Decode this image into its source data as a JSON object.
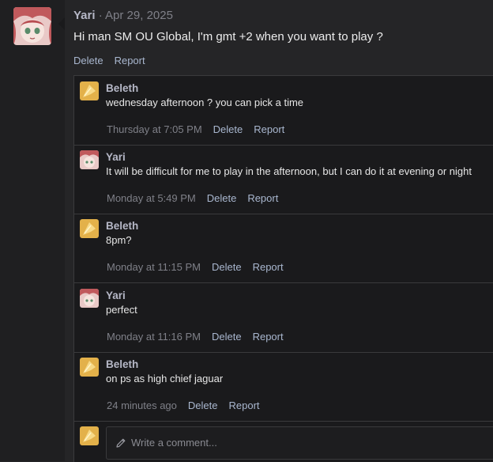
{
  "post": {
    "author": "Yari",
    "separator": " · ",
    "date": "Apr 29, 2025",
    "body": "Hi man SM OU Global, I'm gmt +2 when you want to play ?",
    "delete_label": "Delete",
    "report_label": "Report"
  },
  "comments": [
    {
      "author": "Beleth",
      "avatar": "beleth",
      "text": "wednesday afternoon ? you can pick a time",
      "time": "Thursday at 7:05 PM",
      "delete_label": "Delete",
      "report_label": "Report"
    },
    {
      "author": "Yari",
      "avatar": "yari",
      "text": "It will be difficult for me to play in the afternoon, but I can do it at evening or night",
      "time": "Monday at 5:49 PM",
      "delete_label": "Delete",
      "report_label": "Report"
    },
    {
      "author": "Beleth",
      "avatar": "beleth",
      "text": "8pm?",
      "time": "Monday at 11:15 PM",
      "delete_label": "Delete",
      "report_label": "Report"
    },
    {
      "author": "Yari",
      "avatar": "yari",
      "text": "perfect",
      "time": "Monday at 11:16 PM",
      "delete_label": "Delete",
      "report_label": "Report"
    },
    {
      "author": "Beleth",
      "avatar": "beleth",
      "text": "on ps as high chief jaguar",
      "time": "24 minutes ago",
      "delete_label": "Delete",
      "report_label": "Report"
    }
  ],
  "reply": {
    "placeholder": "Write a comment...",
    "icon": "pencil-icon"
  },
  "colors": {
    "background": "#252527",
    "rail": "#1f1f21",
    "panel": "#1a1a1c",
    "author": "#b6b8c7",
    "link": "#a9b7cf",
    "muted": "#7f8088"
  }
}
